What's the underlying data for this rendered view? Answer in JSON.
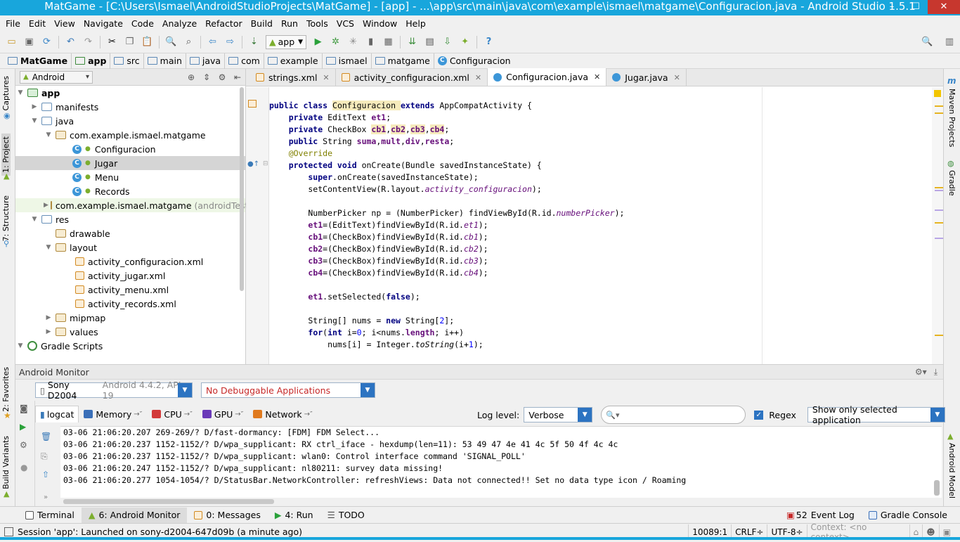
{
  "window": {
    "title": "MatGame - [C:\\Users\\Ismael\\AndroidStudioProjects\\MatGame] - [app] - ...\\app\\src\\main\\java\\com\\example\\ismael\\matgame\\Configuracion.java - Android Studio 1.5.1"
  },
  "menu": [
    "File",
    "Edit",
    "View",
    "Navigate",
    "Code",
    "Analyze",
    "Refactor",
    "Build",
    "Run",
    "Tools",
    "VCS",
    "Window",
    "Help"
  ],
  "toolbar": {
    "app_config": "app"
  },
  "breadcrumb": [
    "MatGame",
    "app",
    "src",
    "main",
    "java",
    "com",
    "example",
    "ismael",
    "matgame",
    "Configuracion"
  ],
  "project": {
    "view_mode": "Android",
    "tree": [
      {
        "label": "app",
        "suffix": ""
      },
      {
        "label": "manifests",
        "suffix": ""
      },
      {
        "label": "java",
        "suffix": ""
      },
      {
        "label": "com.example.ismael.matgame",
        "suffix": ""
      },
      {
        "label": "Configuracion",
        "suffix": ""
      },
      {
        "label": "Jugar",
        "suffix": ""
      },
      {
        "label": "Menu",
        "suffix": ""
      },
      {
        "label": "Records",
        "suffix": ""
      },
      {
        "label": "com.example.ismael.matgame",
        "suffix": "(androidTest)"
      },
      {
        "label": "res",
        "suffix": ""
      },
      {
        "label": "drawable",
        "suffix": ""
      },
      {
        "label": "layout",
        "suffix": ""
      },
      {
        "label": "activity_configuracion.xml",
        "suffix": ""
      },
      {
        "label": "activity_jugar.xml",
        "suffix": ""
      },
      {
        "label": "activity_menu.xml",
        "suffix": ""
      },
      {
        "label": "activity_records.xml",
        "suffix": ""
      },
      {
        "label": "mipmap",
        "suffix": ""
      },
      {
        "label": "values",
        "suffix": ""
      },
      {
        "label": "Gradle Scripts",
        "suffix": ""
      }
    ]
  },
  "editor": {
    "tabs": [
      "strings.xml",
      "activity_configuracion.xml",
      "Configuracion.java",
      "Jugar.java"
    ],
    "code": [
      {
        "p": [
          "public class ",
          "Configuracion ",
          "extends ",
          "AppCompatActivity {"
        ]
      },
      {
        "p": [
          "    private ",
          "EditText ",
          "et1",
          ";"
        ]
      },
      {
        "p": [
          "    private ",
          "CheckBox ",
          "cb1",
          ",",
          "cb2",
          ",",
          "cb3",
          ",",
          "cb4",
          ";"
        ]
      },
      {
        "p": [
          "    public ",
          "String ",
          "suma",
          ",",
          "mult",
          ",",
          "div",
          ",",
          "resta",
          ";"
        ]
      },
      {
        "p": [
          "    @Override"
        ]
      },
      {
        "p": [
          "    protected void ",
          "onCreate(Bundle savedInstanceState) {"
        ]
      },
      {
        "p": [
          "        super",
          ".onCreate(savedInstanceState);"
        ]
      },
      {
        "p": [
          "        setContentView(R.layout.",
          "activity_configuracion",
          ");"
        ]
      },
      {
        "p": [
          ""
        ]
      },
      {
        "p": [
          "        NumberPicker np = (NumberPicker) findViewById(R.id.",
          "numberPicker",
          ");"
        ]
      },
      {
        "p": [
          "        ",
          "et1",
          "=(EditText)findViewById(R.id.",
          "et1",
          ");"
        ]
      },
      {
        "p": [
          "        ",
          "cb1",
          "=(CheckBox)findViewById(R.id.",
          "cb1",
          ");"
        ]
      },
      {
        "p": [
          "        ",
          "cb2",
          "=(CheckBox)findViewById(R.id.",
          "cb2",
          ");"
        ]
      },
      {
        "p": [
          "        ",
          "cb3",
          "=(CheckBox)findViewById(R.id.",
          "cb3",
          ");"
        ]
      },
      {
        "p": [
          "        ",
          "cb4",
          "=(CheckBox)findViewById(R.id.",
          "cb4",
          ");"
        ]
      },
      {
        "p": [
          ""
        ]
      },
      {
        "p": [
          "        ",
          "et1",
          ".setSelected(",
          "false",
          ");"
        ]
      },
      {
        "p": [
          ""
        ]
      },
      {
        "p": [
          "        String[] nums = ",
          "new ",
          "String[",
          "2",
          "];"
        ]
      },
      {
        "p": [
          "        ",
          "for",
          "(",
          "int ",
          "i=",
          "0",
          "; i<nums.",
          "length",
          "; i++)"
        ]
      },
      {
        "p": [
          "            nums[i] = Integer.",
          "toString",
          "(i+",
          "1",
          ");"
        ]
      }
    ]
  },
  "monitor": {
    "title": "Android Monitor",
    "device_name": "Sony D2004",
    "device_info": "Android 4.4.2, API 19",
    "app_select": "No Debuggable Applications",
    "tabs": [
      "logcat",
      "Memory",
      "CPU",
      "GPU",
      "Network"
    ],
    "log_level_label": "Log level:",
    "log_level_value": "Verbose",
    "search_placeholder": "",
    "regex_label": "Regex",
    "filter_value": "Show only selected application",
    "log_lines": [
      "03-06 21:06:20.207 269-269/? D/fast-dormancy: [FDM] FDM Select...",
      "03-06 21:06:20.237 1152-1152/? D/wpa_supplicant: RX ctrl_iface - hexdump(len=11): 53 49 47 4e 41 4c 5f 50 4f 4c 4c",
      "03-06 21:06:20.237 1152-1152/? D/wpa_supplicant: wlan0: Control interface command 'SIGNAL_POLL'",
      "03-06 21:06:20.247 1152-1152/? D/wpa_supplicant: nl80211: survey data missing!",
      "03-06 21:06:20.277 1054-1054/? D/StatusBar.NetworkController: refreshViews: Data not connected!! Set no data type icon / Roaming"
    ]
  },
  "left_strip": {
    "captures": "Captures",
    "project": "1: Project",
    "structure": "7: Structure",
    "favorites": "2: Favorites",
    "build_variants": "Build Variants"
  },
  "right_strip": {
    "maven": "Maven Projects",
    "gradle": "Gradle",
    "android_model": "Android Model"
  },
  "bottom_tabs": {
    "terminal": "Terminal",
    "android_monitor": "6: Android Monitor",
    "messages": "0: Messages",
    "run": "4: Run",
    "todo": "TODO",
    "event_log": "Event Log",
    "event_log_count": "52",
    "gradle_console": "Gradle Console"
  },
  "status": {
    "message": "Session 'app': Launched on sony-d2004-647d09b (a minute ago)",
    "position": "10089:1",
    "line_sep": "CRLF÷",
    "encoding": "UTF-8÷",
    "context": "Context: <no context>"
  },
  "colors": {
    "titlebar": "#18a6dc",
    "keyword": "#000080",
    "field": "#660e7a",
    "annotation": "#808000",
    "select_blue": "#2c73c1"
  }
}
